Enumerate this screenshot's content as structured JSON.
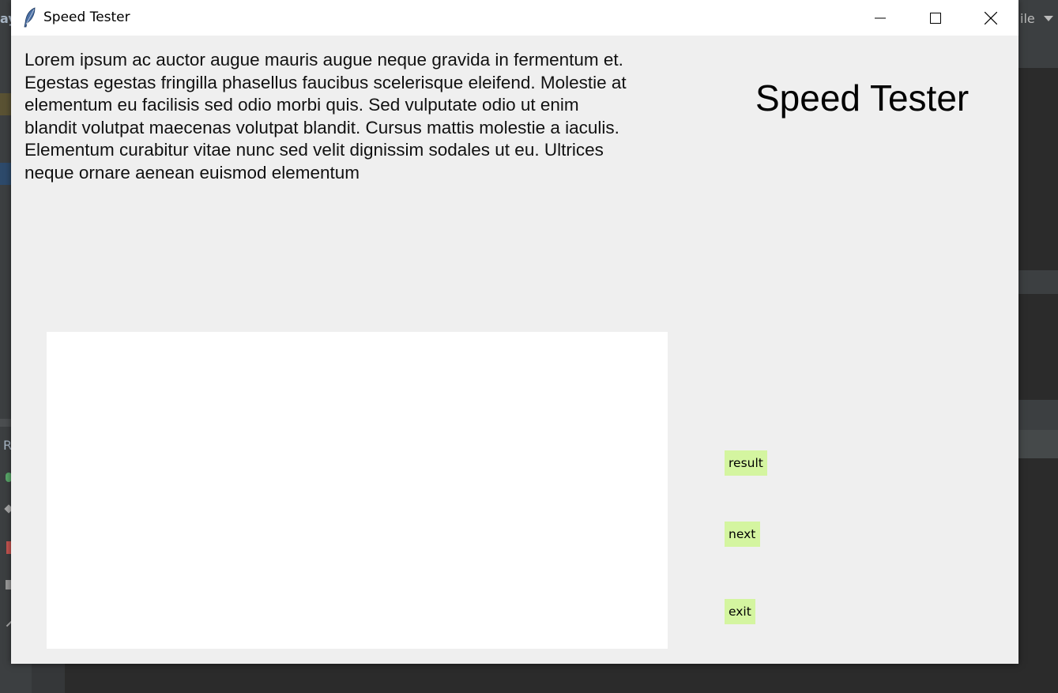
{
  "window": {
    "title": "Speed Tester"
  },
  "main": {
    "sample_text": "Lorem ipsum ac auctor augue mauris augue neque gravida in fermentum et. Egestas egestas fringilla phasellus faucibus scelerisque eleifend. Molestie at elementum eu facilisis sed odio morbi quis. Sed vulputate odio ut enim blandit volutpat maecenas volutpat blandit. Cursus mattis molestie a iaculis. Elementum curabitur vitae nunc sed velit dignissim sodales ut eu. Ultrices neque ornare aenean euismod elementum",
    "heading": "Speed Tester",
    "input_value": ""
  },
  "buttons": {
    "result": "result",
    "next": "next",
    "exit": "exit"
  },
  "background": {
    "left_fragment": "ay",
    "left_fragment_2": "R",
    "right_fragment": "ile"
  },
  "colors": {
    "button_bg": "#d4f5a0",
    "client_bg": "#efefef",
    "ide_bg": "#2b2b2b"
  },
  "icons": {
    "app": "feather-icon",
    "minimize": "minimize-icon",
    "maximize": "maximize-icon",
    "close": "close-icon"
  }
}
